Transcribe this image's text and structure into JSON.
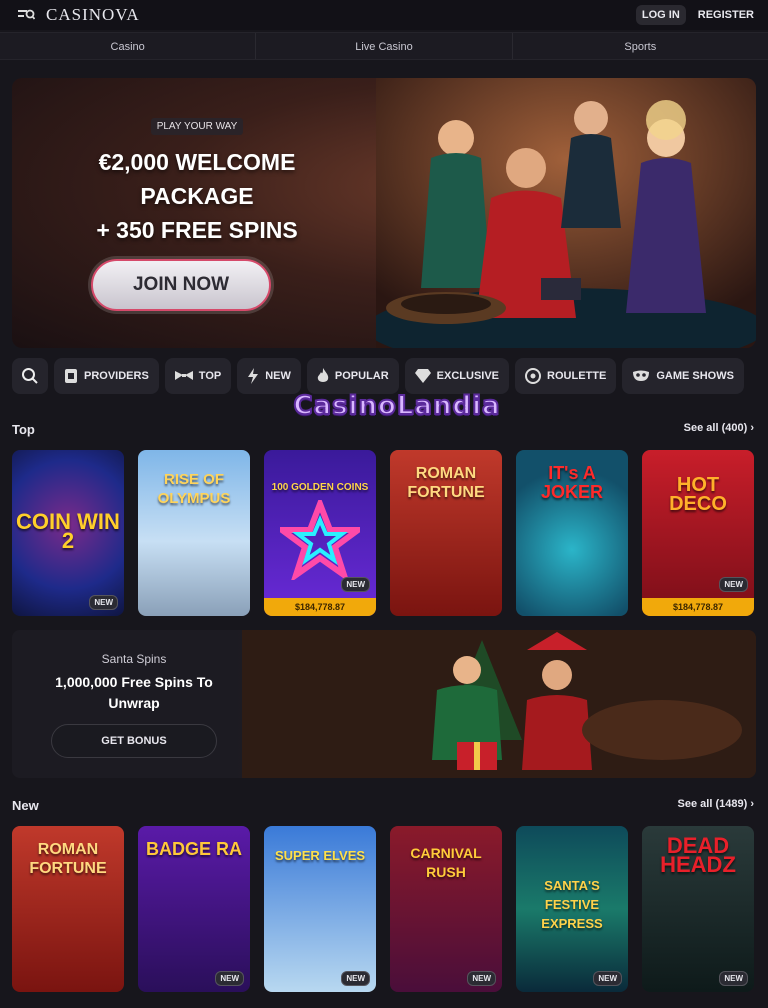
{
  "header": {
    "logo": "CASINOVA",
    "login_label": "LOG IN",
    "register_label": "REGISTER"
  },
  "nav": [
    "Casino",
    "Live Casino",
    "Sports"
  ],
  "hero": {
    "tag": "PLAY YOUR WAY",
    "title_line1": "€2,000 WELCOME",
    "title_line2": "PACKAGE",
    "title_line3": "+ 350 FREE SPINS",
    "cta": "JOIN NOW"
  },
  "filters": [
    {
      "label": "PROVIDERS",
      "icon": "provider-icon"
    },
    {
      "label": "TOP",
      "icon": "bowtie-icon"
    },
    {
      "label": "NEW",
      "icon": "lightning-icon"
    },
    {
      "label": "POPULAR",
      "icon": "flame-icon"
    },
    {
      "label": "EXCLUSIVE",
      "icon": "diamond-icon"
    },
    {
      "label": "ROULETTE",
      "icon": "roulette-icon"
    },
    {
      "label": "GAME SHOWS",
      "icon": "mask-icon"
    }
  ],
  "watermark": "CasinoLandia",
  "top_section": {
    "title": "Top",
    "see_all": "See all (400)",
    "games": [
      {
        "name": "COIN WIN 2",
        "badge": "NEW",
        "jackpot": ""
      },
      {
        "name": "RISE OF OLYMPUS",
        "badge": "",
        "jackpot": ""
      },
      {
        "name": "100 GOLDEN COINS",
        "badge": "NEW",
        "jackpot": "$184,778.87"
      },
      {
        "name": "ROMAN FORTUNE",
        "badge": "",
        "jackpot": ""
      },
      {
        "name": "IT's A JOKER",
        "badge": "",
        "jackpot": ""
      },
      {
        "name": "HOT DECO",
        "badge": "NEW",
        "jackpot": "$184,778.87"
      }
    ]
  },
  "promo": {
    "kicker": "Santa Spins",
    "title_line1": "1,000,000 Free Spins To",
    "title_line2": "Unwrap",
    "cta": "GET BONUS"
  },
  "new_section": {
    "title": "New",
    "see_all": "See all (1489)",
    "games": [
      {
        "name": "ROMAN FORTUNE",
        "badge": ""
      },
      {
        "name": "BADGE RA",
        "badge": "NEW"
      },
      {
        "name": "SUPER ELVES",
        "badge": "NEW"
      },
      {
        "name": "CARNIVAL RUSH",
        "badge": "NEW"
      },
      {
        "name": "SANTA'S FESTIVE EXPRESS",
        "badge": "NEW"
      },
      {
        "name": "DEAD HEADZ",
        "badge": "NEW"
      }
    ]
  },
  "colors": {
    "page_bg": "#17161c",
    "chip_bg": "#25242c",
    "jackpot_bar": "#f1a90b",
    "hero_cta_border": "#d54a6a"
  }
}
